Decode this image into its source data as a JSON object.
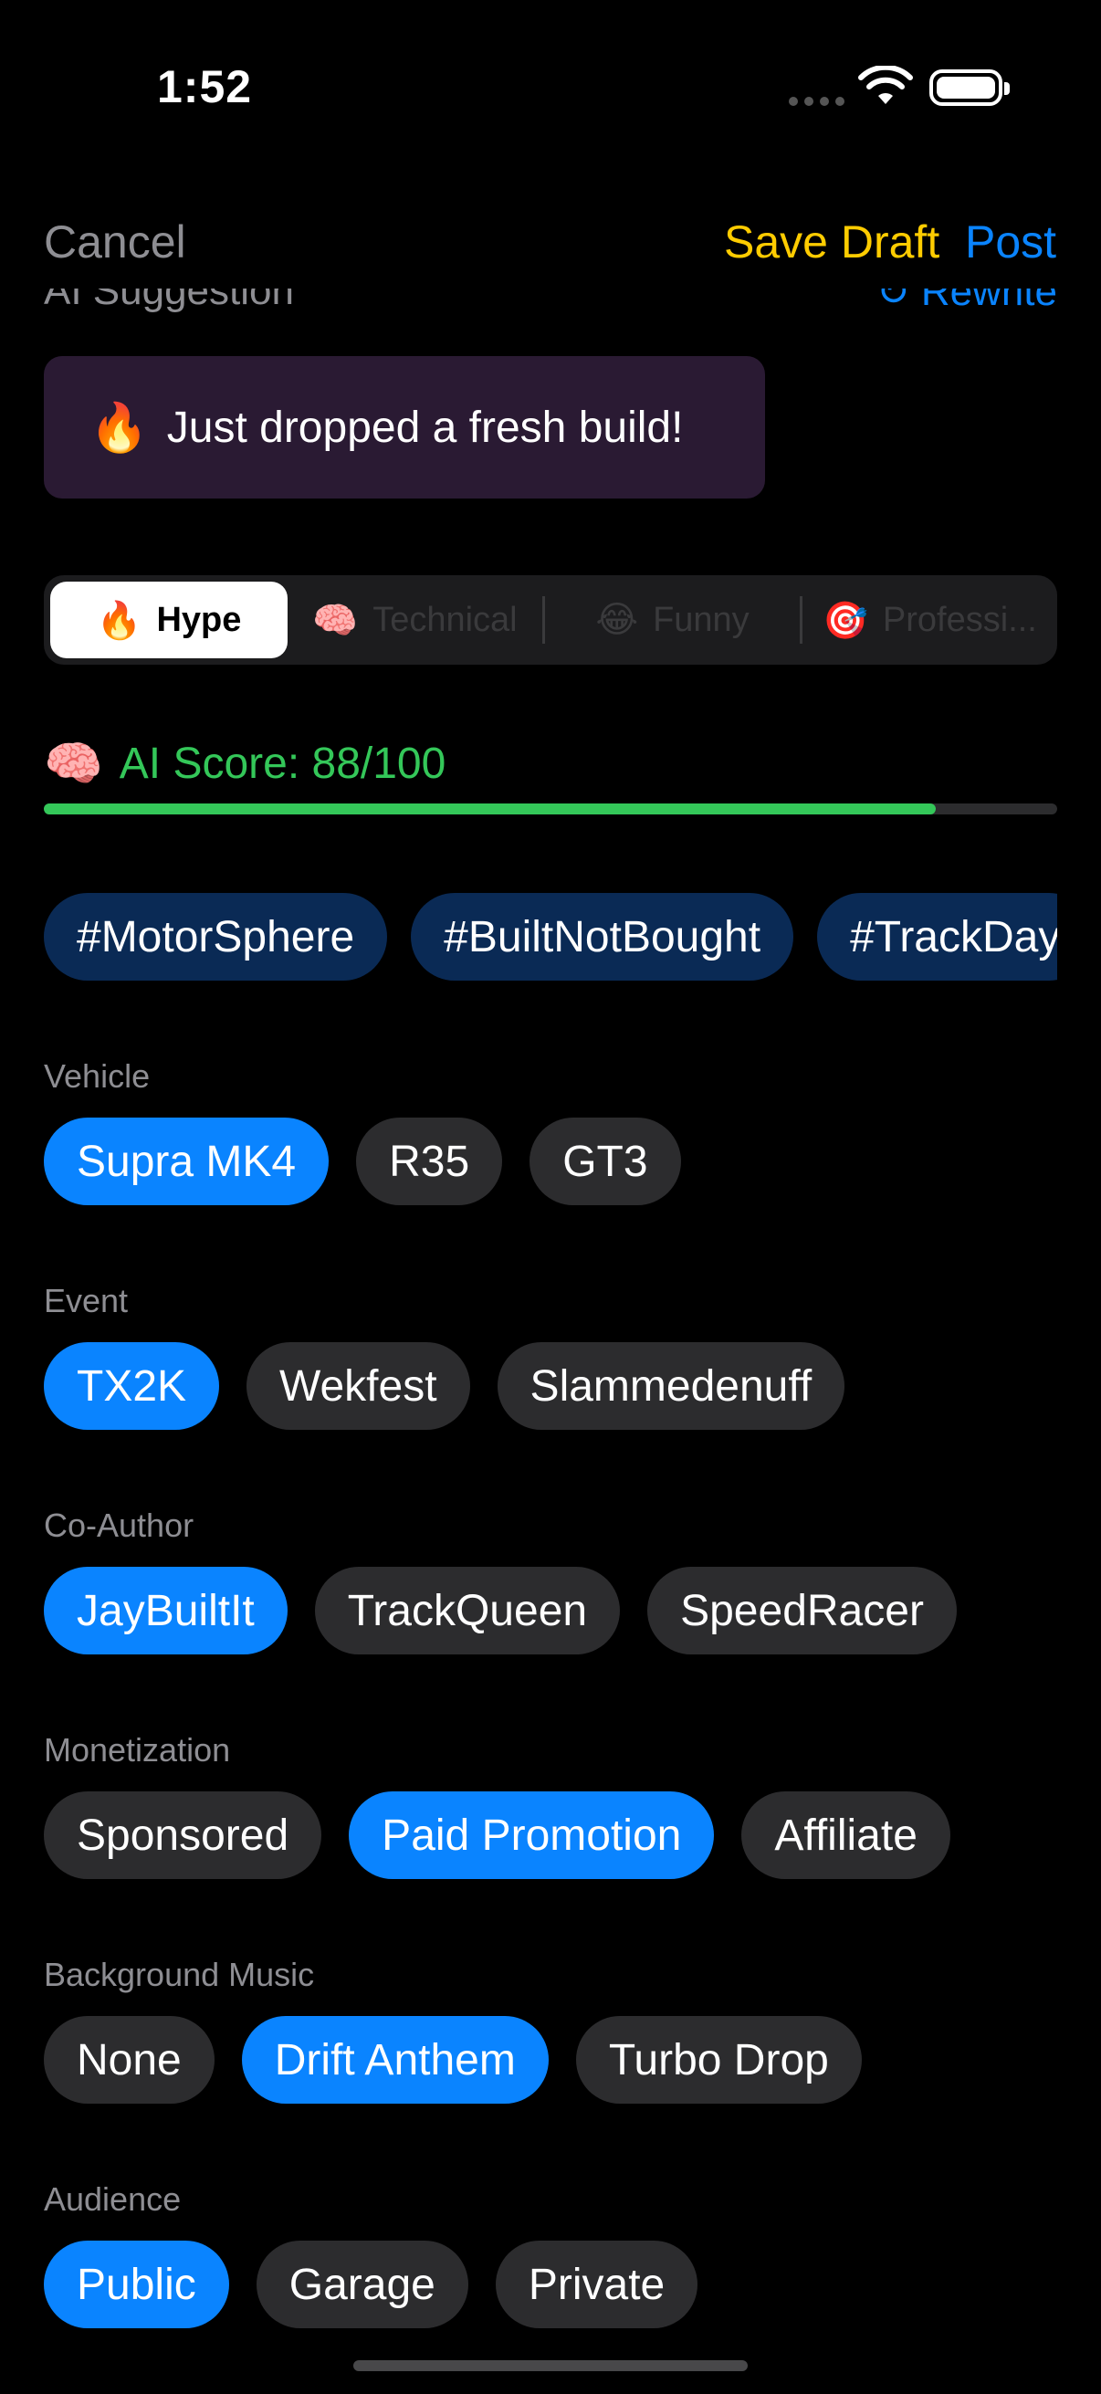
{
  "status_bar": {
    "time": "1:52"
  },
  "nav": {
    "cancel": "Cancel",
    "save_draft": "Save Draft",
    "post": "Post"
  },
  "ai_suggestion": {
    "label": "AI Suggestion",
    "rewrite": "↻ Rewrite",
    "emoji": "🔥",
    "text": "Just dropped a fresh build!"
  },
  "tones": [
    {
      "emoji": "🔥",
      "label": "Hype"
    },
    {
      "emoji": "🧠",
      "label": "Technical"
    },
    {
      "emoji": "😂",
      "label": "Funny"
    },
    {
      "emoji": "🎯",
      "label": "Professi..."
    }
  ],
  "score": {
    "emoji": "🧠",
    "text": "AI Score: 88/100",
    "value": 88,
    "max": 100
  },
  "hashtags": [
    "#MotorSphere",
    "#BuiltNotBought",
    "#TrackDay"
  ],
  "sections": {
    "vehicle": {
      "label": "Vehicle",
      "options": [
        "Supra MK4",
        "R35",
        "GT3"
      ]
    },
    "event": {
      "label": "Event",
      "options": [
        "TX2K",
        "Wekfest",
        "Slammedenuff"
      ]
    },
    "coauthor": {
      "label": "Co-Author",
      "options": [
        "JayBuiltIt",
        "TrackQueen",
        "SpeedRacer"
      ]
    },
    "monetization": {
      "label": "Monetization",
      "options": [
        "Sponsored",
        "Paid Promotion",
        "Affiliate"
      ]
    },
    "music": {
      "label": "Background Music",
      "options": [
        "None",
        "Drift Anthem",
        "Turbo Drop"
      ]
    },
    "audience": {
      "label": "Audience",
      "options": [
        "Public",
        "Garage",
        "Private"
      ]
    }
  },
  "colors": {
    "accent": "#0a84ff",
    "draft": "#ffcc00",
    "score": "#34c759",
    "chip": "#2c2c2e"
  }
}
